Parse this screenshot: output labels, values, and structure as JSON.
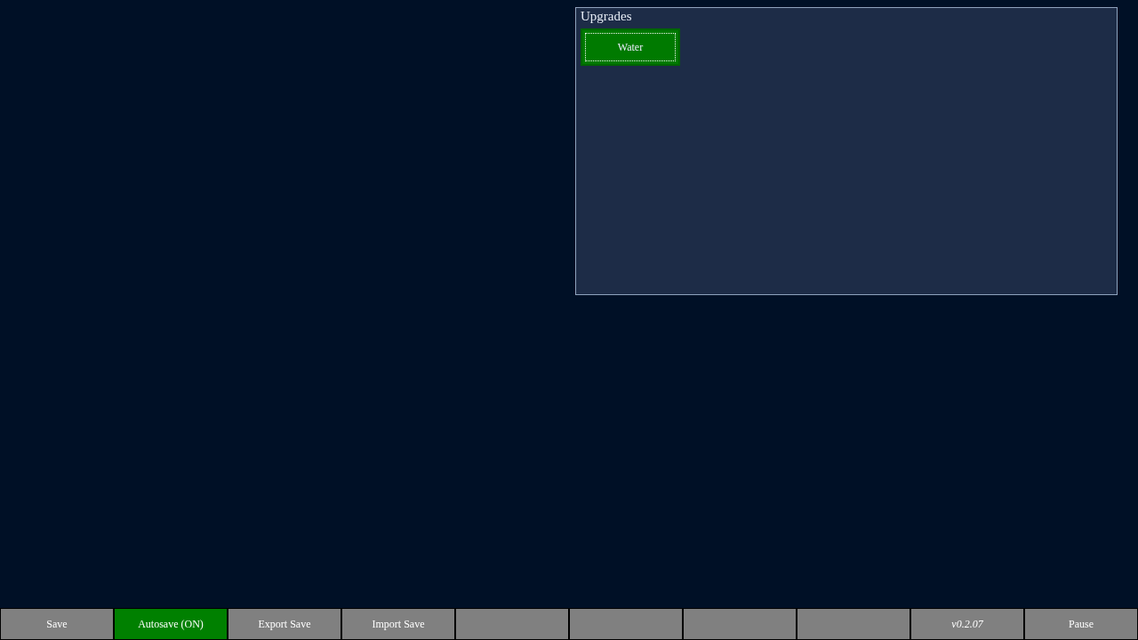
{
  "upgrades": {
    "title": "Upgrades",
    "items": [
      {
        "label": "Water",
        "focused": true
      }
    ]
  },
  "footer": [
    {
      "kind": "button",
      "label": "Save",
      "on": false
    },
    {
      "kind": "button",
      "label": "Autosave (ON)",
      "on": true
    },
    {
      "kind": "button",
      "label": "Export Save",
      "on": false
    },
    {
      "kind": "button",
      "label": "Import Save",
      "on": false
    },
    {
      "kind": "blank"
    },
    {
      "kind": "blank"
    },
    {
      "kind": "blank"
    },
    {
      "kind": "blank"
    },
    {
      "kind": "version",
      "label": "v0.2.07"
    },
    {
      "kind": "button",
      "label": "Pause",
      "on": false
    }
  ]
}
